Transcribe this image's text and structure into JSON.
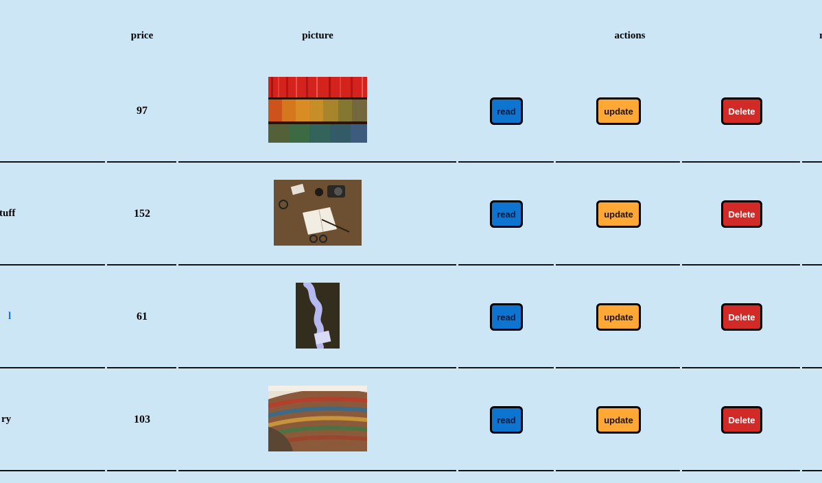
{
  "headers": {
    "price": "price",
    "picture": "picture",
    "actions": "actions",
    "last_partial": "r"
  },
  "rows": [
    {
      "name_fragment": "",
      "price": "97",
      "picture": "bookshelf-photo",
      "read_label": "read",
      "update_label": "update",
      "delete_label": "Delete"
    },
    {
      "name_fragment": "tuff",
      "price": "152",
      "picture": "desk-items-photo",
      "read_label": "read",
      "update_label": "update",
      "delete_label": "Delete"
    },
    {
      "name_fragment": "l",
      "price": "61",
      "picture": "paper-path-photo",
      "read_label": "read",
      "update_label": "update",
      "delete_label": "Delete"
    },
    {
      "name_fragment": "ry",
      "price": "103",
      "picture": "library-photo",
      "read_label": "read",
      "update_label": "update",
      "delete_label": "Delete"
    }
  ],
  "colors": {
    "background": "#cce6f6",
    "read_button": "#0d74d0",
    "update_button": "#ffa836",
    "delete_button": "#d22b27",
    "link_fragment": "#1a6fd1"
  }
}
